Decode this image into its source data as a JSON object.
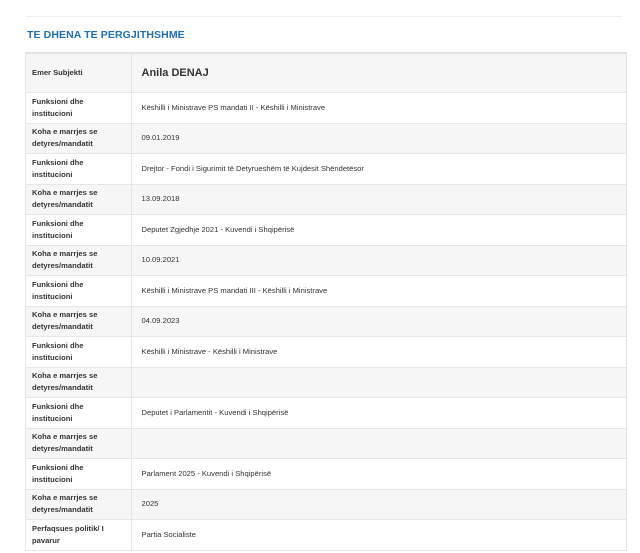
{
  "section": {
    "title": "TE DHENA TE PERGJITHSHME"
  },
  "subject": {
    "label": "Emer Subjekti",
    "value": "Anila DENAJ"
  },
  "rows": [
    {
      "label": "Funksioni dhe institucioni",
      "value": "Këshilli i Ministrave PS mandati II - Këshilli i Ministrave"
    },
    {
      "label": "Koha e marrjes se detyres/mandatit",
      "value": "09.01.2019"
    },
    {
      "label": "Funksioni dhe institucioni",
      "value": "Drejtor - Fondi i Sigurimit të Detyrueshëm të Kujdesit Shëndetësor"
    },
    {
      "label": "Koha e marrjes se detyres/mandatit",
      "value": "13.09.2018"
    },
    {
      "label": "Funksioni dhe institucioni",
      "value": "Deputet Zgjedhje 2021 - Kuvendi i Shqipërisë"
    },
    {
      "label": "Koha e marrjes se detyres/mandatit",
      "value": "10.09.2021"
    },
    {
      "label": "Funksioni dhe institucioni",
      "value": "Këshilli i Ministrave PS mandati III - Këshilli i Ministrave"
    },
    {
      "label": "Koha e marrjes se detyres/mandatit",
      "value": "04.09.2023"
    },
    {
      "label": "Funksioni dhe institucioni",
      "value": "Këshilli i Ministrave - Këshilli i Ministrave"
    },
    {
      "label": "Koha e marrjes se detyres/mandatit",
      "value": ""
    },
    {
      "label": "Funksioni dhe institucioni",
      "value": "Deputet i Parlamentit - Kuvendi i Shqipërisë"
    },
    {
      "label": "Koha e marrjes se detyres/mandatit",
      "value": ""
    },
    {
      "label": "Funksioni dhe institucioni",
      "value": "Parlament 2025 - Kuvendi i Shqipërisë"
    },
    {
      "label": "Koha e marrjes se detyres/mandatit",
      "value": "2025"
    },
    {
      "label": "Perfaqsues politik/ I pavarur",
      "value": "Partia Socialiste"
    }
  ],
  "colors": {
    "title": "#1f6fb5",
    "stripe": "#f6f6f6",
    "border": "#e6e6e6"
  }
}
